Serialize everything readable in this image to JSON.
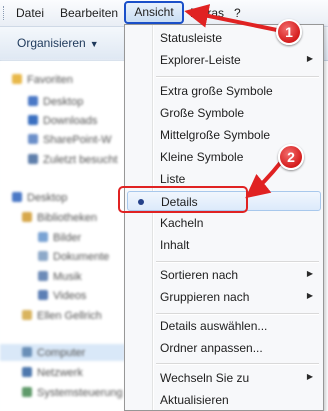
{
  "menubar": {
    "items": [
      "Datei",
      "Bearbeiten",
      "Ansicht",
      "Extras",
      "?"
    ]
  },
  "toolbar": {
    "organize_label": "Organisieren"
  },
  "nav_pane": {
    "items": [
      "Favoriten",
      "Desktop",
      "Downloads",
      "SharePoint-W",
      "Zuletzt besucht",
      "Desktop",
      "Bibliotheken",
      "Bilder",
      "Dokumente",
      "Musik",
      "Videos",
      "Ellen Gellrich",
      "Computer",
      "Netzwerk",
      "Systemsteuerung"
    ]
  },
  "menu": {
    "items": [
      "Statusleiste",
      "Explorer-Leiste",
      "Extra große Symbole",
      "Große Symbole",
      "Mittelgroße Symbole",
      "Kleine Symbole",
      "Liste",
      "Details",
      "Kacheln",
      "Inhalt",
      "Sortieren nach",
      "Gruppieren nach",
      "Details auswählen...",
      "Ordner anpassen...",
      "Wechseln Sie zu",
      "Aktualisieren"
    ],
    "selected": "Details"
  },
  "annotations": {
    "badge1": "1",
    "badge2": "2"
  },
  "colors": {
    "annotation_red": "#e02222",
    "menubar_highlight": "#1a4fc9"
  }
}
